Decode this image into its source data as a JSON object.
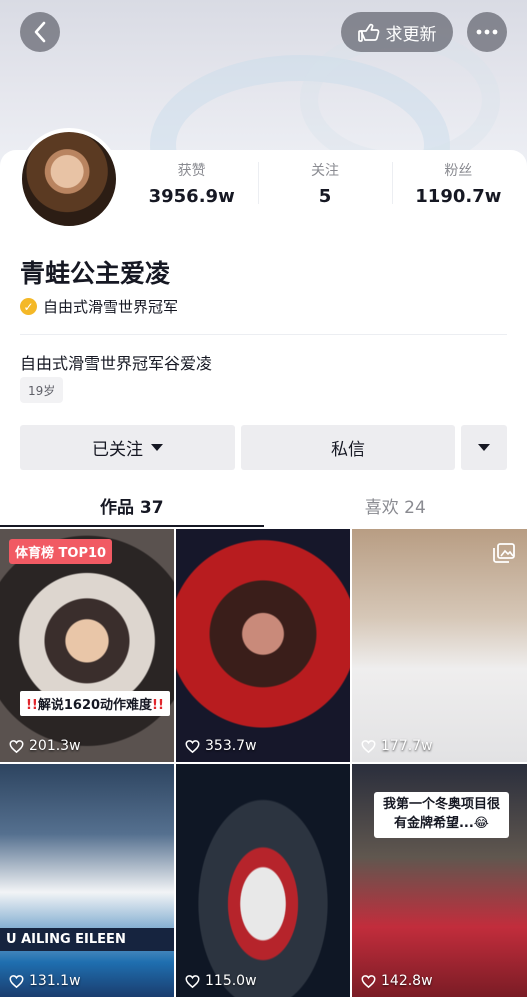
{
  "header": {
    "update_label": "求更新"
  },
  "profile": {
    "name": "青蛙公主爱凌",
    "verification": "自由式滑雪世界冠军",
    "bio": "自由式滑雪世界冠军谷爱凌",
    "age": "19岁"
  },
  "stats": [
    {
      "label": "获赞",
      "value": "3956.9w"
    },
    {
      "label": "关注",
      "value": "5"
    },
    {
      "label": "粉丝",
      "value": "1190.7w"
    }
  ],
  "actions": {
    "follow_label": "已关注",
    "message_label": "私信"
  },
  "tabs": [
    {
      "label": "作品 37",
      "active": true
    },
    {
      "label": "喜欢 24",
      "active": false
    }
  ],
  "posts": [
    {
      "likes": "201.3w",
      "badge": "体育榜 TOP10",
      "caption_mark": "!!",
      "caption": "解说1620动作难度",
      "caption_mark_end": "!!"
    },
    {
      "likes": "353.7w"
    },
    {
      "likes": "177.7w",
      "icon": "image-gallery-icon"
    },
    {
      "likes": "131.1w",
      "ticker": "U AILING EILEEN"
    },
    {
      "likes": "115.0w"
    },
    {
      "likes": "142.8w",
      "caption": "我第一个冬奥项目很有金牌希望...😂"
    }
  ],
  "colors": {
    "accent_badge": "#f15a63",
    "verify": "#f4b827",
    "text_primary": "#161823",
    "text_secondary": "#8a8b91"
  }
}
